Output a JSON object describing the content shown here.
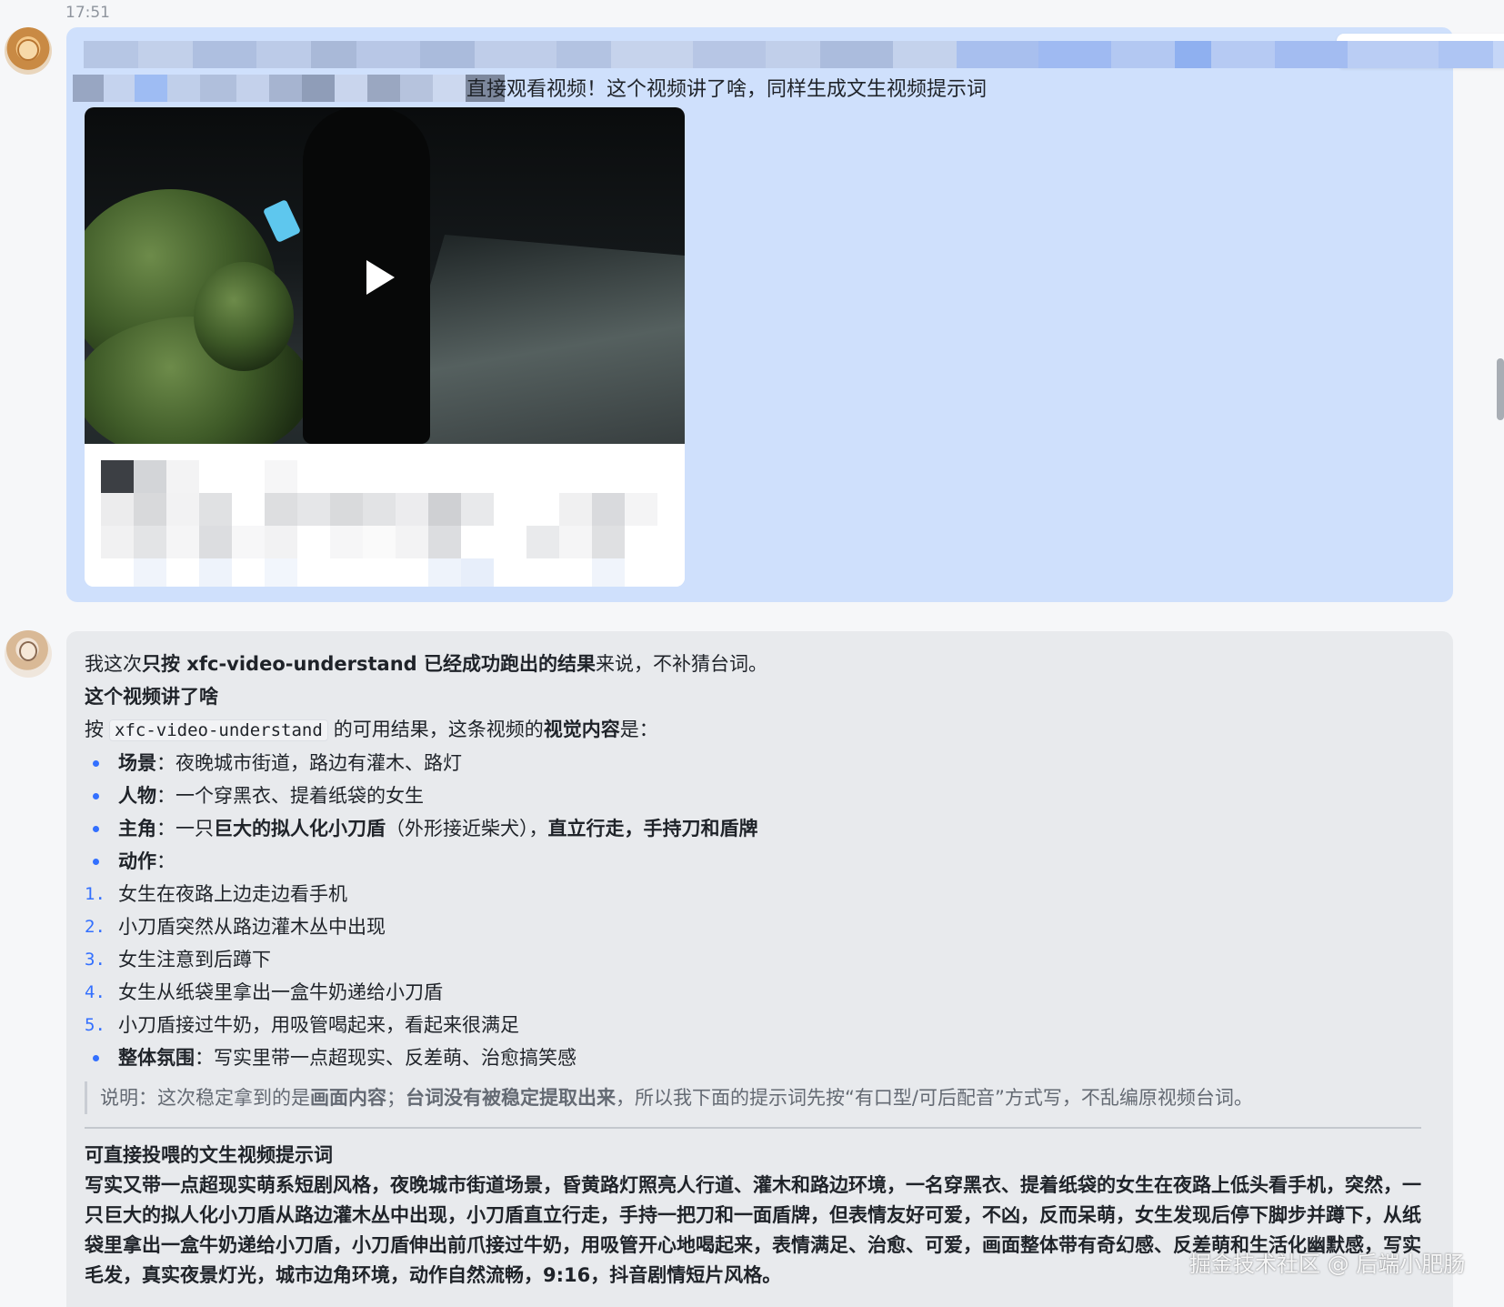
{
  "timestamp": "17:51",
  "toolbar": {
    "icons": [
      "thumbs-up-icon",
      "comment-icon",
      "forward-icon",
      "pin-icon",
      "more-icon"
    ]
  },
  "user_message": {
    "visible_text": "直接观看视频！这个视频讲了啥，同样生成文生视频提示词",
    "video": {
      "play_icon": "play-icon"
    }
  },
  "bot_message": {
    "intro_prefix": "我这次",
    "intro_bold": "只按 xfc-video-understand 已经成功跑出的结果",
    "intro_suffix": "来说，不补猜台词。",
    "section_title": "这个视频讲了啥",
    "line2_prefix": "按",
    "line2_code": "xfc-video-understand",
    "line2_middle": "的可用结果，这条视频的",
    "line2_bold": "视觉内容",
    "line2_suffix": "是：",
    "bullets": [
      {
        "label": "场景",
        "sep": "：",
        "text": "夜晚城市街道，路边有灌木、路灯"
      },
      {
        "label": "人物",
        "sep": "：",
        "text": "一个穿黑衣、提着纸袋的女生"
      }
    ],
    "protagonist": {
      "label": "主角",
      "sep": "：",
      "text1": "一只",
      "bold1": "巨大的拟人化小刀盾",
      "text2": "（外形接近柴犬），",
      "bold2": "直立行走，手持刀和盾牌"
    },
    "action": {
      "label": "动作",
      "sep": "："
    },
    "steps": [
      {
        "num": "1.",
        "text": "女生在夜路上边走边看手机"
      },
      {
        "num": "2.",
        "text": "小刀盾突然从路边灌木丛中出现"
      },
      {
        "num": "3.",
        "text": "女生注意到后蹲下"
      },
      {
        "num": "4.",
        "text": "女生从纸袋里拿出一盒牛奶递给小刀盾"
      },
      {
        "num": "5.",
        "text": "小刀盾接过牛奶，用吸管喝起来，看起来很满足"
      }
    ],
    "atmosphere": {
      "label": "整体氛围",
      "sep": "：",
      "text": "写实里带一点超现实、反差萌、治愈搞笑感"
    },
    "note": {
      "prefix": "说明：这次稳定拿到的是",
      "bold1": "画面内容",
      "mid": "；",
      "bold2": "台词没有被稳定提取出来",
      "suffix": "，所以我下面的提示词先按“有口型/可后配音”方式写，不乱编原视频台词。"
    },
    "prompt_title": "可直接投喂的文生视频提示词",
    "prompt_body": "写实又带一点超现实萌系短剧风格，夜晚城市街道场景，昏黄路灯照亮人行道、灌木和路边环境，一名穿黑衣、提着纸袋的女生在夜路上低头看手机，突然，一只巨大的拟人化小刀盾从路边灌木丛中出现，小刀盾直立行走，手持一把刀和一面盾牌，但表情友好可爱，不凶，反而呆萌，女生发现后停下脚步并蹲下，从纸袋里拿出一盒牛奶递给小刀盾，小刀盾伸出前爪接过牛奶，用吸管开心地喝起来，表情满足、治愈、可爱，画面整体带有奇幻感、反差萌和生活化幽默感，写实毛发，真实夜景灯光，城市边角环境，动作自然流畅，9:16，抖音剧情短片风格。"
  },
  "watermark": "掘金技术社区 @ 后端小肥肠"
}
